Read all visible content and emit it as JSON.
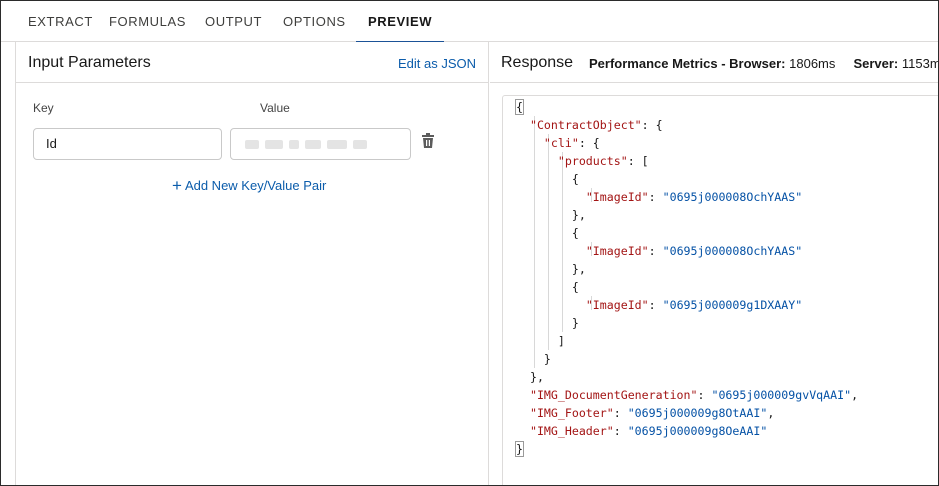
{
  "tabs": [
    {
      "label": "EXTRACT",
      "active": false
    },
    {
      "label": "FORMULAS",
      "active": false
    },
    {
      "label": "OUTPUT",
      "active": false
    },
    {
      "label": "OPTIONS",
      "active": false
    },
    {
      "label": "PREVIEW",
      "active": true
    }
  ],
  "input_panel": {
    "title": "Input Parameters",
    "edit_json_label": "Edit as JSON",
    "key_label": "Key",
    "value_label": "Value",
    "key_value": "Id",
    "value_value_redacted": true,
    "add_pair_label": "Add New Key/Value Pair",
    "delete_icon": "trash-icon"
  },
  "response_panel": {
    "title": "Response",
    "metrics_label": "Performance Metrics - Browser:",
    "browser_time": "1806ms",
    "server_label": "Server:",
    "server_time": "1153m"
  },
  "json_lines": [
    {
      "parts": [
        {
          "t": "{",
          "c": "p"
        }
      ]
    },
    {
      "parts": [
        {
          "t": "\"ContractObject\"",
          "c": "k"
        },
        {
          "t": ": {",
          "c": "p"
        }
      ]
    },
    {
      "parts": [
        {
          "t": "\"cli\"",
          "c": "k"
        },
        {
          "t": ": {",
          "c": "p"
        }
      ]
    },
    {
      "parts": [
        {
          "t": "\"products\"",
          "c": "k"
        },
        {
          "t": ": [",
          "c": "p"
        }
      ]
    },
    {
      "parts": [
        {
          "t": "{",
          "c": "p"
        }
      ]
    },
    {
      "parts": [
        {
          "t": "\"ImageId\"",
          "c": "k"
        },
        {
          "t": ": ",
          "c": "p"
        },
        {
          "t": "\"0695j000008OchYAAS\"",
          "c": "s"
        }
      ]
    },
    {
      "parts": [
        {
          "t": "},",
          "c": "p"
        }
      ]
    },
    {
      "parts": [
        {
          "t": "{",
          "c": "p"
        }
      ]
    },
    {
      "parts": [
        {
          "t": "\"ImageId\"",
          "c": "k"
        },
        {
          "t": ": ",
          "c": "p"
        },
        {
          "t": "\"0695j000008OchYAAS\"",
          "c": "s"
        }
      ]
    },
    {
      "parts": [
        {
          "t": "},",
          "c": "p"
        }
      ]
    },
    {
      "parts": [
        {
          "t": "{",
          "c": "p"
        }
      ]
    },
    {
      "parts": [
        {
          "t": "\"ImageId\"",
          "c": "k"
        },
        {
          "t": ": ",
          "c": "p"
        },
        {
          "t": "\"0695j000009g1DXAAY\"",
          "c": "s"
        }
      ]
    },
    {
      "parts": [
        {
          "t": "}",
          "c": "p"
        }
      ]
    },
    {
      "parts": [
        {
          "t": "]",
          "c": "p"
        }
      ]
    },
    {
      "parts": [
        {
          "t": "}",
          "c": "p"
        }
      ]
    },
    {
      "parts": [
        {
          "t": "},",
          "c": "p"
        }
      ]
    },
    {
      "parts": [
        {
          "t": "\"IMG_DocumentGeneration\"",
          "c": "k"
        },
        {
          "t": ": ",
          "c": "p"
        },
        {
          "t": "\"0695j000009gvVqAAI\"",
          "c": "s"
        },
        {
          "t": ",",
          "c": "p"
        }
      ]
    },
    {
      "parts": [
        {
          "t": "\"IMG_Footer\"",
          "c": "k"
        },
        {
          "t": ": ",
          "c": "p"
        },
        {
          "t": "\"0695j000009g8OtAAI\"",
          "c": "s"
        },
        {
          "t": ",",
          "c": "p"
        }
      ]
    },
    {
      "parts": [
        {
          "t": "\"IMG_Header\"",
          "c": "k"
        },
        {
          "t": ": ",
          "c": "p"
        },
        {
          "t": "\"0695j000009g8OeAAI\"",
          "c": "s"
        }
      ]
    },
    {
      "parts": [
        {
          "t": "}",
          "c": "p"
        }
      ]
    }
  ],
  "colors": {
    "accent": "#0b5cab",
    "active_tab_underline": "#1b5297",
    "json_key": "#a31515",
    "json_string": "#0451a5"
  }
}
